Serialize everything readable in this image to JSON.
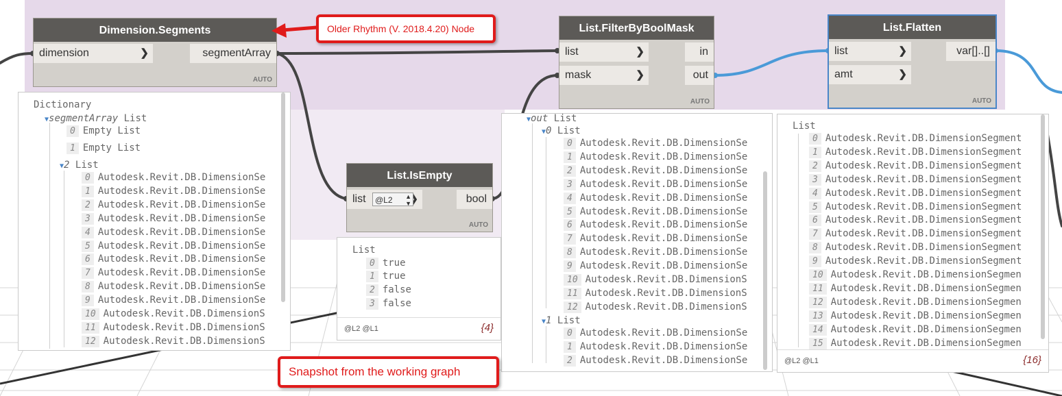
{
  "colors": {
    "group": "#e6d9ea",
    "node_title": "#5c5a57",
    "node_body": "#d3d0cb",
    "wire_selected": "#4a9ad8",
    "wire": "#444444",
    "callout": "#e01b1b"
  },
  "nodes": {
    "segments": {
      "title": "Dimension.Segments",
      "in": [
        "dimension"
      ],
      "out": [
        "segmentArray"
      ],
      "lacing": "AUTO"
    },
    "isempty": {
      "title": "List.IsEmpty",
      "in": [
        "list"
      ],
      "out": [
        "bool"
      ],
      "level_value": "@L2",
      "lacing": "AUTO"
    },
    "filter": {
      "title": "List.FilterByBoolMask",
      "in": [
        "list",
        "mask"
      ],
      "out": [
        "in",
        "out"
      ],
      "lacing": "AUTO"
    },
    "flatten": {
      "title": "List.Flatten",
      "in": [
        "list",
        "amt"
      ],
      "out": [
        "var[]..[]"
      ],
      "lacing": "AUTO"
    }
  },
  "callouts": {
    "older": "Older Rhythm (V. 2018.4.20) Node",
    "snapshot": "Snapshot from the working graph"
  },
  "preview1": {
    "header": "Dictionary",
    "key": "segmentArray",
    "key_type": "List",
    "rows": [
      {
        "i": "0",
        "t": "Empty List"
      },
      {
        "i": "1",
        "t": "Empty List"
      }
    ],
    "sub_index": "2",
    "sub_type": "List",
    "sub_rows": [
      "0",
      "1",
      "2",
      "3",
      "4",
      "5",
      "6",
      "7",
      "8",
      "9",
      "10",
      "11",
      "12"
    ],
    "item_text": "Autodesk.Revit.DB.DimensionSe",
    "item_text_long": "Autodesk.Revit.DB.DimensionS"
  },
  "preview2": {
    "header": "List",
    "rows": [
      {
        "i": "0",
        "t": "true"
      },
      {
        "i": "1",
        "t": "true"
      },
      {
        "i": "2",
        "t": "false"
      },
      {
        "i": "3",
        "t": "false"
      }
    ],
    "levels": "@L2 @L1",
    "count": "{4}"
  },
  "preview3": {
    "key": "out",
    "key_type": "List",
    "g0": "0",
    "g0_type": "List",
    "g0_rows": [
      "0",
      "1",
      "2",
      "3",
      "4",
      "5",
      "6",
      "7",
      "8",
      "9",
      "10",
      "11",
      "12"
    ],
    "g1": "1",
    "g1_type": "List",
    "g1_rows": [
      "0",
      "1",
      "2"
    ],
    "item_text": "Autodesk.Revit.DB.DimensionSe",
    "item_text_long": "Autodesk.Revit.DB.DimensionS"
  },
  "preview4": {
    "header": "List",
    "rows": [
      "0",
      "1",
      "2",
      "3",
      "4",
      "5",
      "6",
      "7",
      "8",
      "9",
      "10",
      "11",
      "12",
      "13",
      "14",
      "15"
    ],
    "item_text": "Autodesk.Revit.DB.DimensionSegment",
    "item_text_long": "Autodesk.Revit.DB.DimensionSegmen",
    "levels": "@L2 @L1",
    "count": "{16}"
  }
}
